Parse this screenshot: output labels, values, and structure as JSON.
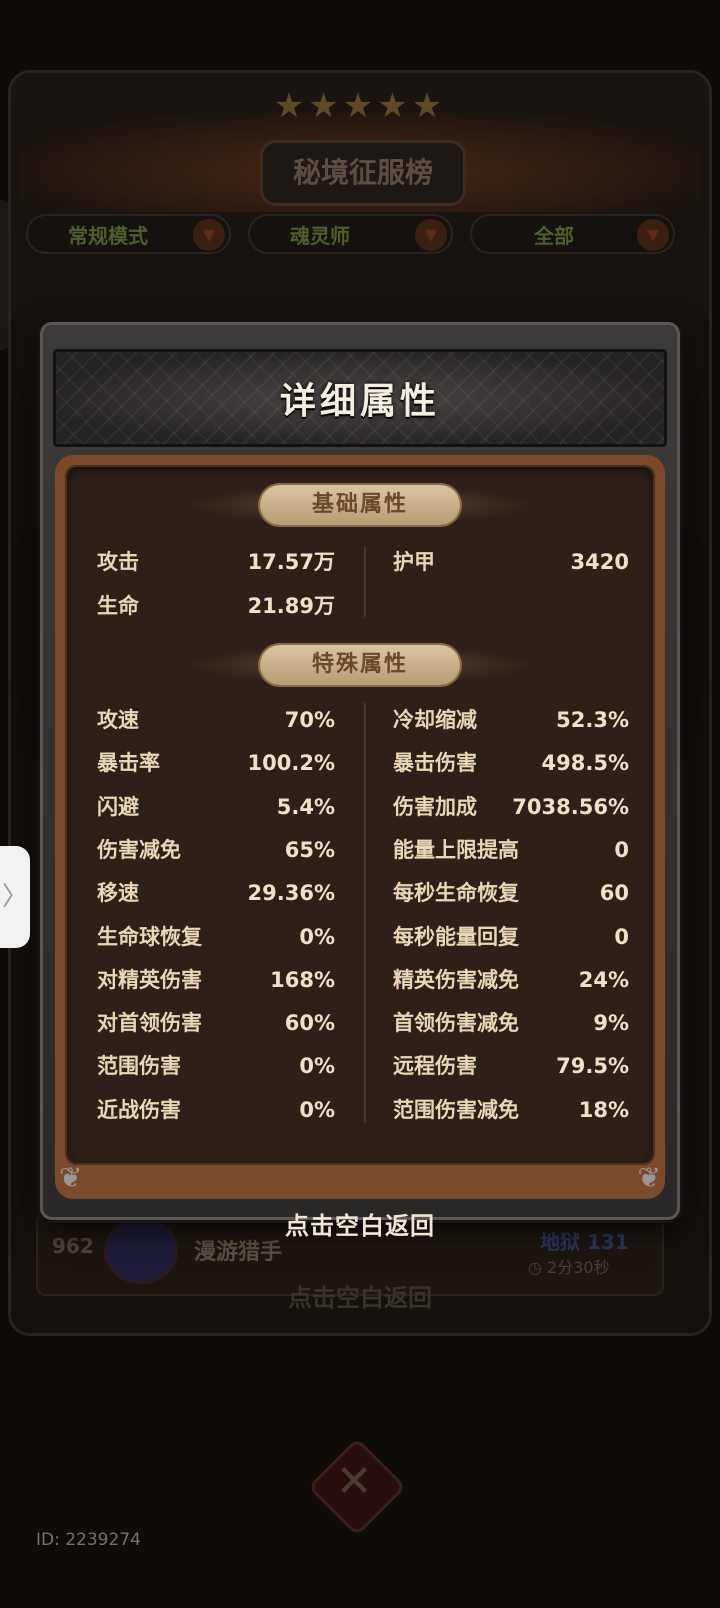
{
  "background": {
    "board_title": "秘境征服榜",
    "filters": [
      {
        "label": "常规模式"
      },
      {
        "label": "魂灵师"
      },
      {
        "label": "全部"
      }
    ],
    "entry": {
      "rank": "962",
      "name": "漫游猎手",
      "floor": "地狱 131",
      "time": "2分30秒"
    }
  },
  "modal": {
    "title": "详细属性",
    "basic_section": {
      "title": "基础属性",
      "left": [
        {
          "label": "攻击",
          "value": "17.57万"
        },
        {
          "label": "生命",
          "value": "21.89万"
        }
      ],
      "right": [
        {
          "label": "护甲",
          "value": "3420"
        }
      ]
    },
    "special_section": {
      "title": "特殊属性",
      "left": [
        {
          "label": "攻速",
          "value": "70%"
        },
        {
          "label": "暴击率",
          "value": "100.2%"
        },
        {
          "label": "闪避",
          "value": "5.4%"
        },
        {
          "label": "伤害减免",
          "value": "65%"
        },
        {
          "label": "移速",
          "value": "29.36%"
        },
        {
          "label": "生命球恢复",
          "value": "0%"
        },
        {
          "label": "对精英伤害",
          "value": "168%"
        },
        {
          "label": "对首领伤害",
          "value": "60%"
        },
        {
          "label": "范围伤害",
          "value": "0%"
        },
        {
          "label": "近战伤害",
          "value": "0%"
        }
      ],
      "right": [
        {
          "label": "冷却缩减",
          "value": "52.3%"
        },
        {
          "label": "暴击伤害",
          "value": "498.5%"
        },
        {
          "label": "伤害加成",
          "value": "7038.56%"
        },
        {
          "label": "能量上限提高",
          "value": "0"
        },
        {
          "label": "每秒生命恢复",
          "value": "60"
        },
        {
          "label": "每秒能量回复",
          "value": "0"
        },
        {
          "label": "精英伤害减免",
          "value": "24%"
        },
        {
          "label": "首领伤害减免",
          "value": "9%"
        },
        {
          "label": "远程伤害",
          "value": "79.5%"
        },
        {
          "label": "范围伤害减免",
          "value": "18%"
        }
      ]
    }
  },
  "return_hint": "点击空白返回",
  "player_id": "ID: 2239274",
  "icons": {
    "side_tab": "chevron-right-icon",
    "close": "close-x-icon",
    "filter_arrow": "triangle-down-icon"
  },
  "colors": {
    "modal_frame": "#3d3a3a",
    "panel_border": "#7a4a2a",
    "panel_bg": "#2d2018",
    "pill_bg": "#d8c4a2",
    "pill_text": "#6a4a2c"
  }
}
